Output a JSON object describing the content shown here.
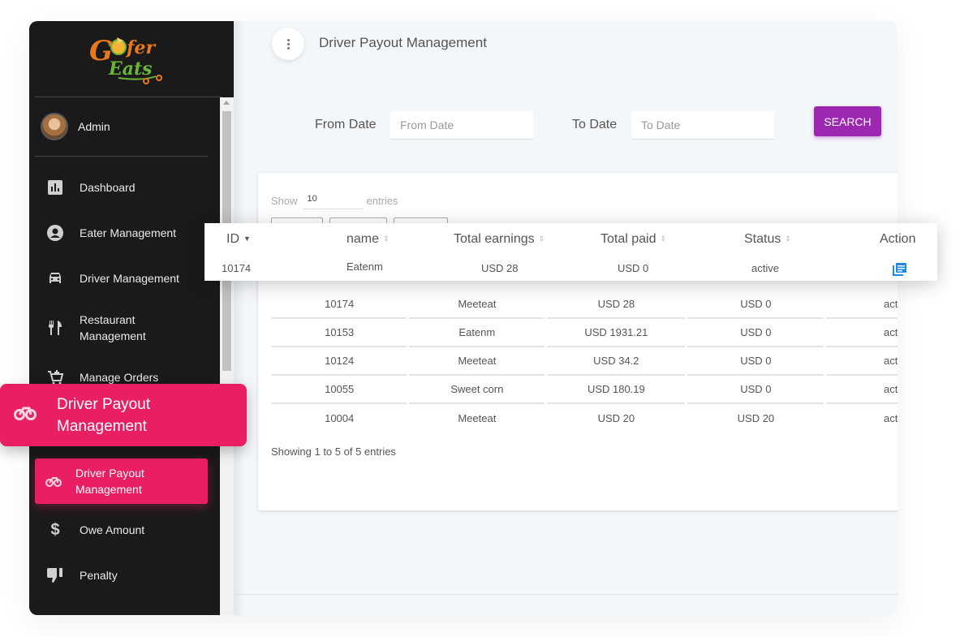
{
  "brand": {
    "logo_line1": "Gofer",
    "logo_line2": "Eats"
  },
  "user": {
    "name": "Admin"
  },
  "sidebar": {
    "items": [
      {
        "label": "Dashboard",
        "icon": "bar-chart-icon"
      },
      {
        "label": "Eater Management",
        "icon": "account-circle-icon"
      },
      {
        "label": "Driver Management",
        "icon": "car-icon"
      },
      {
        "label": "Restaurant Management",
        "icon": "restaurant-icon"
      },
      {
        "label": "Manage Orders",
        "icon": "cart-add-icon"
      },
      {
        "label": "Driver Payout Management",
        "icon": "motorcycle-icon",
        "active": true
      },
      {
        "label": "Owe Amount",
        "icon": "dollar-icon"
      },
      {
        "label": "Penalty",
        "icon": "thumb-down-icon"
      }
    ],
    "highlight": {
      "label_line1": "Driver Payout",
      "label_line2": "Management"
    }
  },
  "header": {
    "title": "Driver Payout Management",
    "menu_icon": "more-vert-icon"
  },
  "filters": {
    "from_label": "From Date",
    "from_placeholder": "From Date",
    "to_label": "To Date",
    "to_placeholder": "To Date",
    "search_label": "SEARCH"
  },
  "table": {
    "show_label": "Show",
    "page_size": "10",
    "entries_label": "entries",
    "columns": [
      "ID",
      "name",
      "Total earnings",
      "Total paid",
      "Status",
      "Action"
    ],
    "sorted_column": "ID",
    "highlight_row": {
      "id": "10174",
      "name": "Eatenm",
      "total_earnings": "USD 28",
      "total_paid": "USD 0",
      "status": "active",
      "action_icon": "view-list-icon"
    },
    "rows": [
      {
        "id": "10174",
        "name": "Meeteat",
        "total_earnings": "USD 28",
        "total_paid": "USD 0",
        "status": "active"
      },
      {
        "id": "10153",
        "name": "Eatenm",
        "total_earnings": "USD 1931.21",
        "total_paid": "USD 0",
        "status": "active"
      },
      {
        "id": "10124",
        "name": "Meeteat",
        "total_earnings": "USD 34.2",
        "total_paid": "USD 0",
        "status": "active"
      },
      {
        "id": "10055",
        "name": "Sweet corn",
        "total_earnings": "USD 180.19",
        "total_paid": "USD 0",
        "status": "active"
      },
      {
        "id": "10004",
        "name": "Meeteat",
        "total_earnings": "USD 20",
        "total_paid": "USD 20",
        "status": "active"
      }
    ],
    "info": "Showing 1 to 5 of 5 entries"
  },
  "colors": {
    "active": "#e91e63",
    "search": "#9c27b0",
    "sidebar_bg": "#1a1a1a",
    "action_icon": "#1e88e5"
  }
}
